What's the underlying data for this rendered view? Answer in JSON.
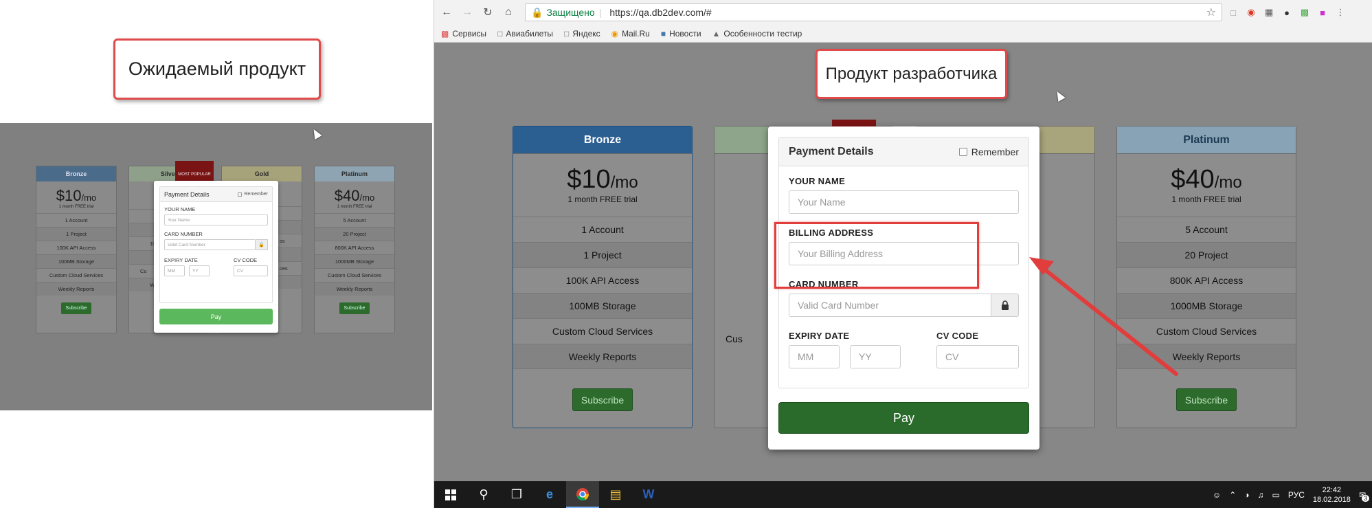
{
  "left": {
    "callout": "Ожидаемый продукт",
    "cards": [
      {
        "name": "Bronze",
        "price": "$10",
        "per": "/mo",
        "trial": "1 month FREE trial",
        "features": [
          "1 Account",
          "1 Project",
          "100K API Access",
          "100MB Storage",
          "Custom Cloud Services",
          "Weekly Reports"
        ],
        "button": "Subscribe"
      },
      {
        "name": "Silver",
        "price": "$",
        "per": "",
        "trial": "",
        "features": [
          "",
          "",
          "10",
          "",
          "Cu",
          "W"
        ],
        "button": ""
      },
      {
        "name": "Gold",
        "price": "",
        "per": "/o",
        "trial": "",
        "features": [
          "",
          "",
          "ss",
          "",
          "ces",
          ""
        ],
        "button": ""
      },
      {
        "name": "Platinum",
        "price": "$40",
        "per": "/mo",
        "trial": "1 month FREE trial",
        "features": [
          "5 Account",
          "20 Project",
          "800K API Access",
          "1000MB Storage",
          "Custom Cloud Services",
          "Weekly Reports"
        ],
        "button": "Subscribe"
      }
    ],
    "ribbon": "MOST POPULAR",
    "modal": {
      "title": "Payment Details",
      "remember": "Remember",
      "name_label": "YOUR NAME",
      "name_placeholder": "Your Name",
      "card_label": "CARD NUMBER",
      "card_placeholder": "Valid Card Number",
      "expiry_label": "EXPIRY DATE",
      "mm": "MM",
      "yy": "YY",
      "cv_label": "CV CODE",
      "cv": "CV",
      "pay": "Pay"
    }
  },
  "browser": {
    "secure_label": "Защищено",
    "url": "https://qa.db2dev.com/#",
    "bookmarks": [
      "Сервисы",
      "Авиабилеты",
      "Яндекс",
      "Mail.Ru",
      "Новости",
      "Особенности тестир"
    ],
    "callout": "Продукт разработчика",
    "cards": [
      {
        "name": "Bronze",
        "price": "$10",
        "per": "/mo",
        "trial": "1 month FREE trial",
        "features": [
          "1 Account",
          "1 Project",
          "100K API Access",
          "100MB Storage",
          "Custom Cloud Services",
          "Weekly Reports"
        ],
        "button": "Subscribe"
      },
      {
        "name": "Platinum",
        "price": "$40",
        "per": "/mo",
        "trial": "1 month FREE trial",
        "features": [
          "5 Account",
          "20 Project",
          "800K API Access",
          "1000MB Storage",
          "Custom Cloud Services",
          "Weekly Reports"
        ],
        "button": "Subscribe"
      }
    ],
    "partial": {
      "silver_row5": "Cus",
      "gold_row5": "ces"
    },
    "modal": {
      "title": "Payment Details",
      "remember": "Remember",
      "name_label": "YOUR NAME",
      "name_placeholder": "Your Name",
      "billing_label": "BILLING ADDRESS",
      "billing_placeholder": "Your Billing Address",
      "card_label": "CARD NUMBER",
      "card_placeholder": "Valid Card Number",
      "expiry_label": "EXPIRY DATE",
      "mm": "MM",
      "yy": "YY",
      "cv_label": "CV CODE",
      "cv": "CV",
      "pay": "Pay"
    },
    "taskbar": {
      "lang": "РУС",
      "time": "22:42",
      "date": "18.02.2018",
      "notifications": "3"
    }
  },
  "icons": {
    "back": "arrow-left-icon",
    "forward": "arrow-right-icon",
    "reload": "reload-icon",
    "home": "home-icon",
    "lock": "lock-icon",
    "star": "star-icon",
    "windows": "windows-icon",
    "search": "search-icon"
  },
  "colors": {
    "callout_border": "#e04a4a",
    "pay_expected": "#5cb85c",
    "pay_dev": "#2a6a2a",
    "bronze_head": "#2c5f91",
    "highlight": "#e23d3d"
  }
}
